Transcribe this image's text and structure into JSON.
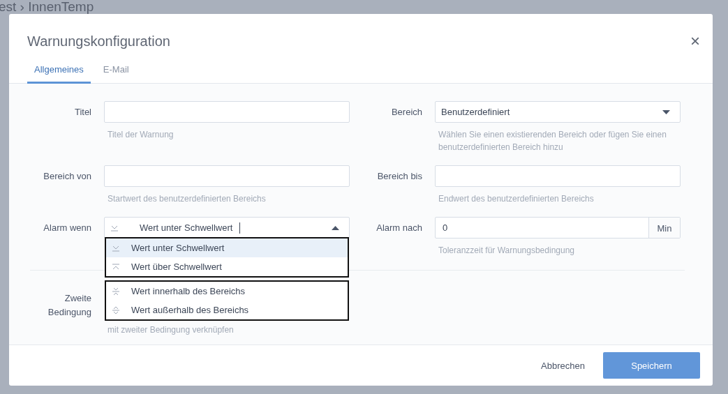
{
  "background": {
    "breadcrumb": "est › InnenTemp"
  },
  "dialog": {
    "title": "Warnungskonfiguration",
    "close": "×",
    "tabs": [
      {
        "label": "Allgemeines",
        "selected": true
      },
      {
        "label": "E-Mail",
        "selected": false
      }
    ],
    "fields": [
      {
        "label": "Titel",
        "kind": "text",
        "hint": "Titel der Warnung"
      },
      {
        "label": "Bereich",
        "kind": "select",
        "value": "Benutzerdefiniert",
        "hint": "Wählen Sie einen existierenden Bereich oder fügen Sie einen benutzerdefinierten Bereich hinzu"
      },
      {
        "label": "Bereich von",
        "kind": "text",
        "hint": "Startwert des benutzerdefinierten Bereichs"
      },
      {
        "label": "Bereich bis",
        "kind": "text",
        "hint": "Endwert des benutzerdefinierten Bereichs"
      },
      {
        "label": "Alarm wenn",
        "kind": "open-select",
        "value": "Wert unter Schwellwert"
      },
      {
        "label": "Alarm nach",
        "kind": "unit",
        "value": "0",
        "unit": "Min",
        "hint": "Toleranzzeit für Warnungsbedingung"
      }
    ],
    "second": {
      "label": "Zweite Bedingung",
      "hint": "mit zweiter Bedingung verknüpfen"
    },
    "options": [
      [
        {
          "label": "Wert unter Schwellwert",
          "selected": true
        },
        {
          "label": "Wert über Schwellwert",
          "selected": false
        }
      ],
      [
        {
          "label": "Wert innerhalb des Bereichs",
          "selected": false
        },
        {
          "label": "Wert außerhalb des Bereichs",
          "selected": false
        }
      ]
    ],
    "buttons": [
      {
        "label": "Abbrechen",
        "kind": "text"
      },
      {
        "label": "Speichern",
        "kind": "primary"
      }
    ]
  }
}
